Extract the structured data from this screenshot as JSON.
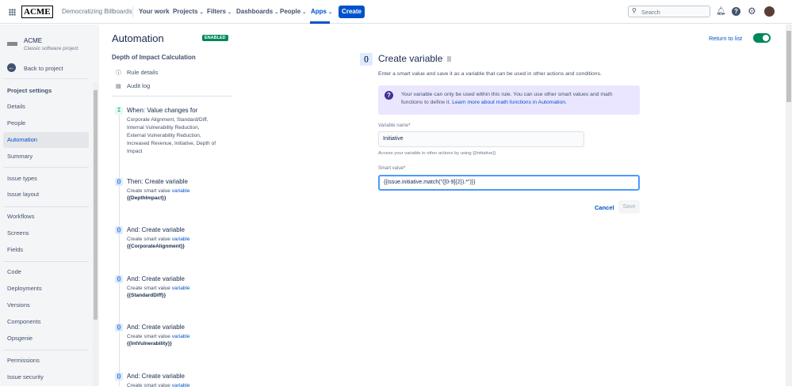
{
  "topbar": {
    "logo": "ACME",
    "project": "Democratizing Billboards",
    "nav": [
      "Your work",
      "Projects",
      "Filters",
      "Dashboards",
      "People",
      "Apps"
    ],
    "create": "Create",
    "search_placeholder": "Search"
  },
  "sidebar": {
    "project_name": "ACME",
    "project_type": "Classic software project",
    "back": "Back to project",
    "section": "Project settings",
    "items": [
      "Details",
      "People",
      "Automation",
      "Summary",
      "Issue types",
      "Issue layout",
      "Workflows",
      "Screens",
      "Fields",
      "Code",
      "Deployments",
      "Versions",
      "Components",
      "Opsgenie",
      "Permissions",
      "Issue security"
    ]
  },
  "header": {
    "title": "Automation",
    "status": "ENABLED",
    "return": "Return to list"
  },
  "rule": {
    "name": "Depth of Impact Calculation",
    "links": [
      "Rule details",
      "Audit log"
    ],
    "trigger": {
      "title": "When: Value changes for",
      "desc": [
        "Corporate Alignment, Standard/Diff,",
        "Internal Vulnerability Reduction,",
        "External Vulnerability Reduction,",
        "Increased Revenue, Initiative, Depth of",
        "Impact"
      ]
    },
    "steps": [
      {
        "title": "Then: Create variable",
        "desc": "Create smart value ",
        "link": "variable",
        "var": "{{DepthImpact}}"
      },
      {
        "title": "And: Create variable",
        "desc": "Create smart value ",
        "link": "variable",
        "var": "{{CorporateAlignment}}"
      },
      {
        "title": "And: Create variable",
        "desc": "Create smart value ",
        "link": "variable",
        "var": "{{StandardDiff}}"
      },
      {
        "title": "And: Create variable",
        "desc": "Create smart value ",
        "link": "variable",
        "var": "{{IntVulnerability}}"
      },
      {
        "title": "And: Create variable",
        "desc": "Create smart value ",
        "link": "variable",
        "var": ""
      }
    ]
  },
  "panel": {
    "icon": "{}",
    "title": "Create variable",
    "subtitle": "Enter a smart value and save it as a variable that can be used in other actions and conditions.",
    "info": "Your variable can only be used within this rule. You can use other smart values and math functions to define it. ",
    "info_link": "Learn more about math functions in Automation.",
    "name_label": "Variable name",
    "name_value": "Initiative",
    "name_help": "Access your variable in other actions by using {{Initiative}}",
    "smart_label": "Smart value",
    "smart_value": "{{issue.initiative.match(\"([0-9]{2}).*\")}}",
    "cancel": "Cancel",
    "save": "Save",
    "required": "*"
  }
}
